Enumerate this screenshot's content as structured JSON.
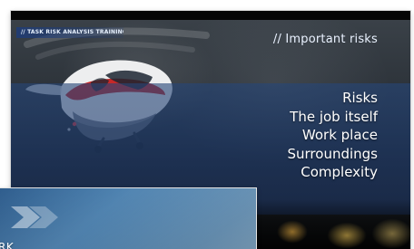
{
  "slide": {
    "tag": "// TASK RISK ANALYSIS TRAINING",
    "section_title": "// Important risks",
    "items": [
      "Risks",
      "The job itself",
      "Work place",
      "Surroundings",
      "Complexity"
    ]
  },
  "overlay": {
    "text": "RK"
  },
  "icons": {
    "helicopter": "helicopter-image",
    "overlay_chevron": "chevron-icon"
  },
  "colors": {
    "blue_band": "#2c4f86",
    "text": "#ffffff"
  }
}
